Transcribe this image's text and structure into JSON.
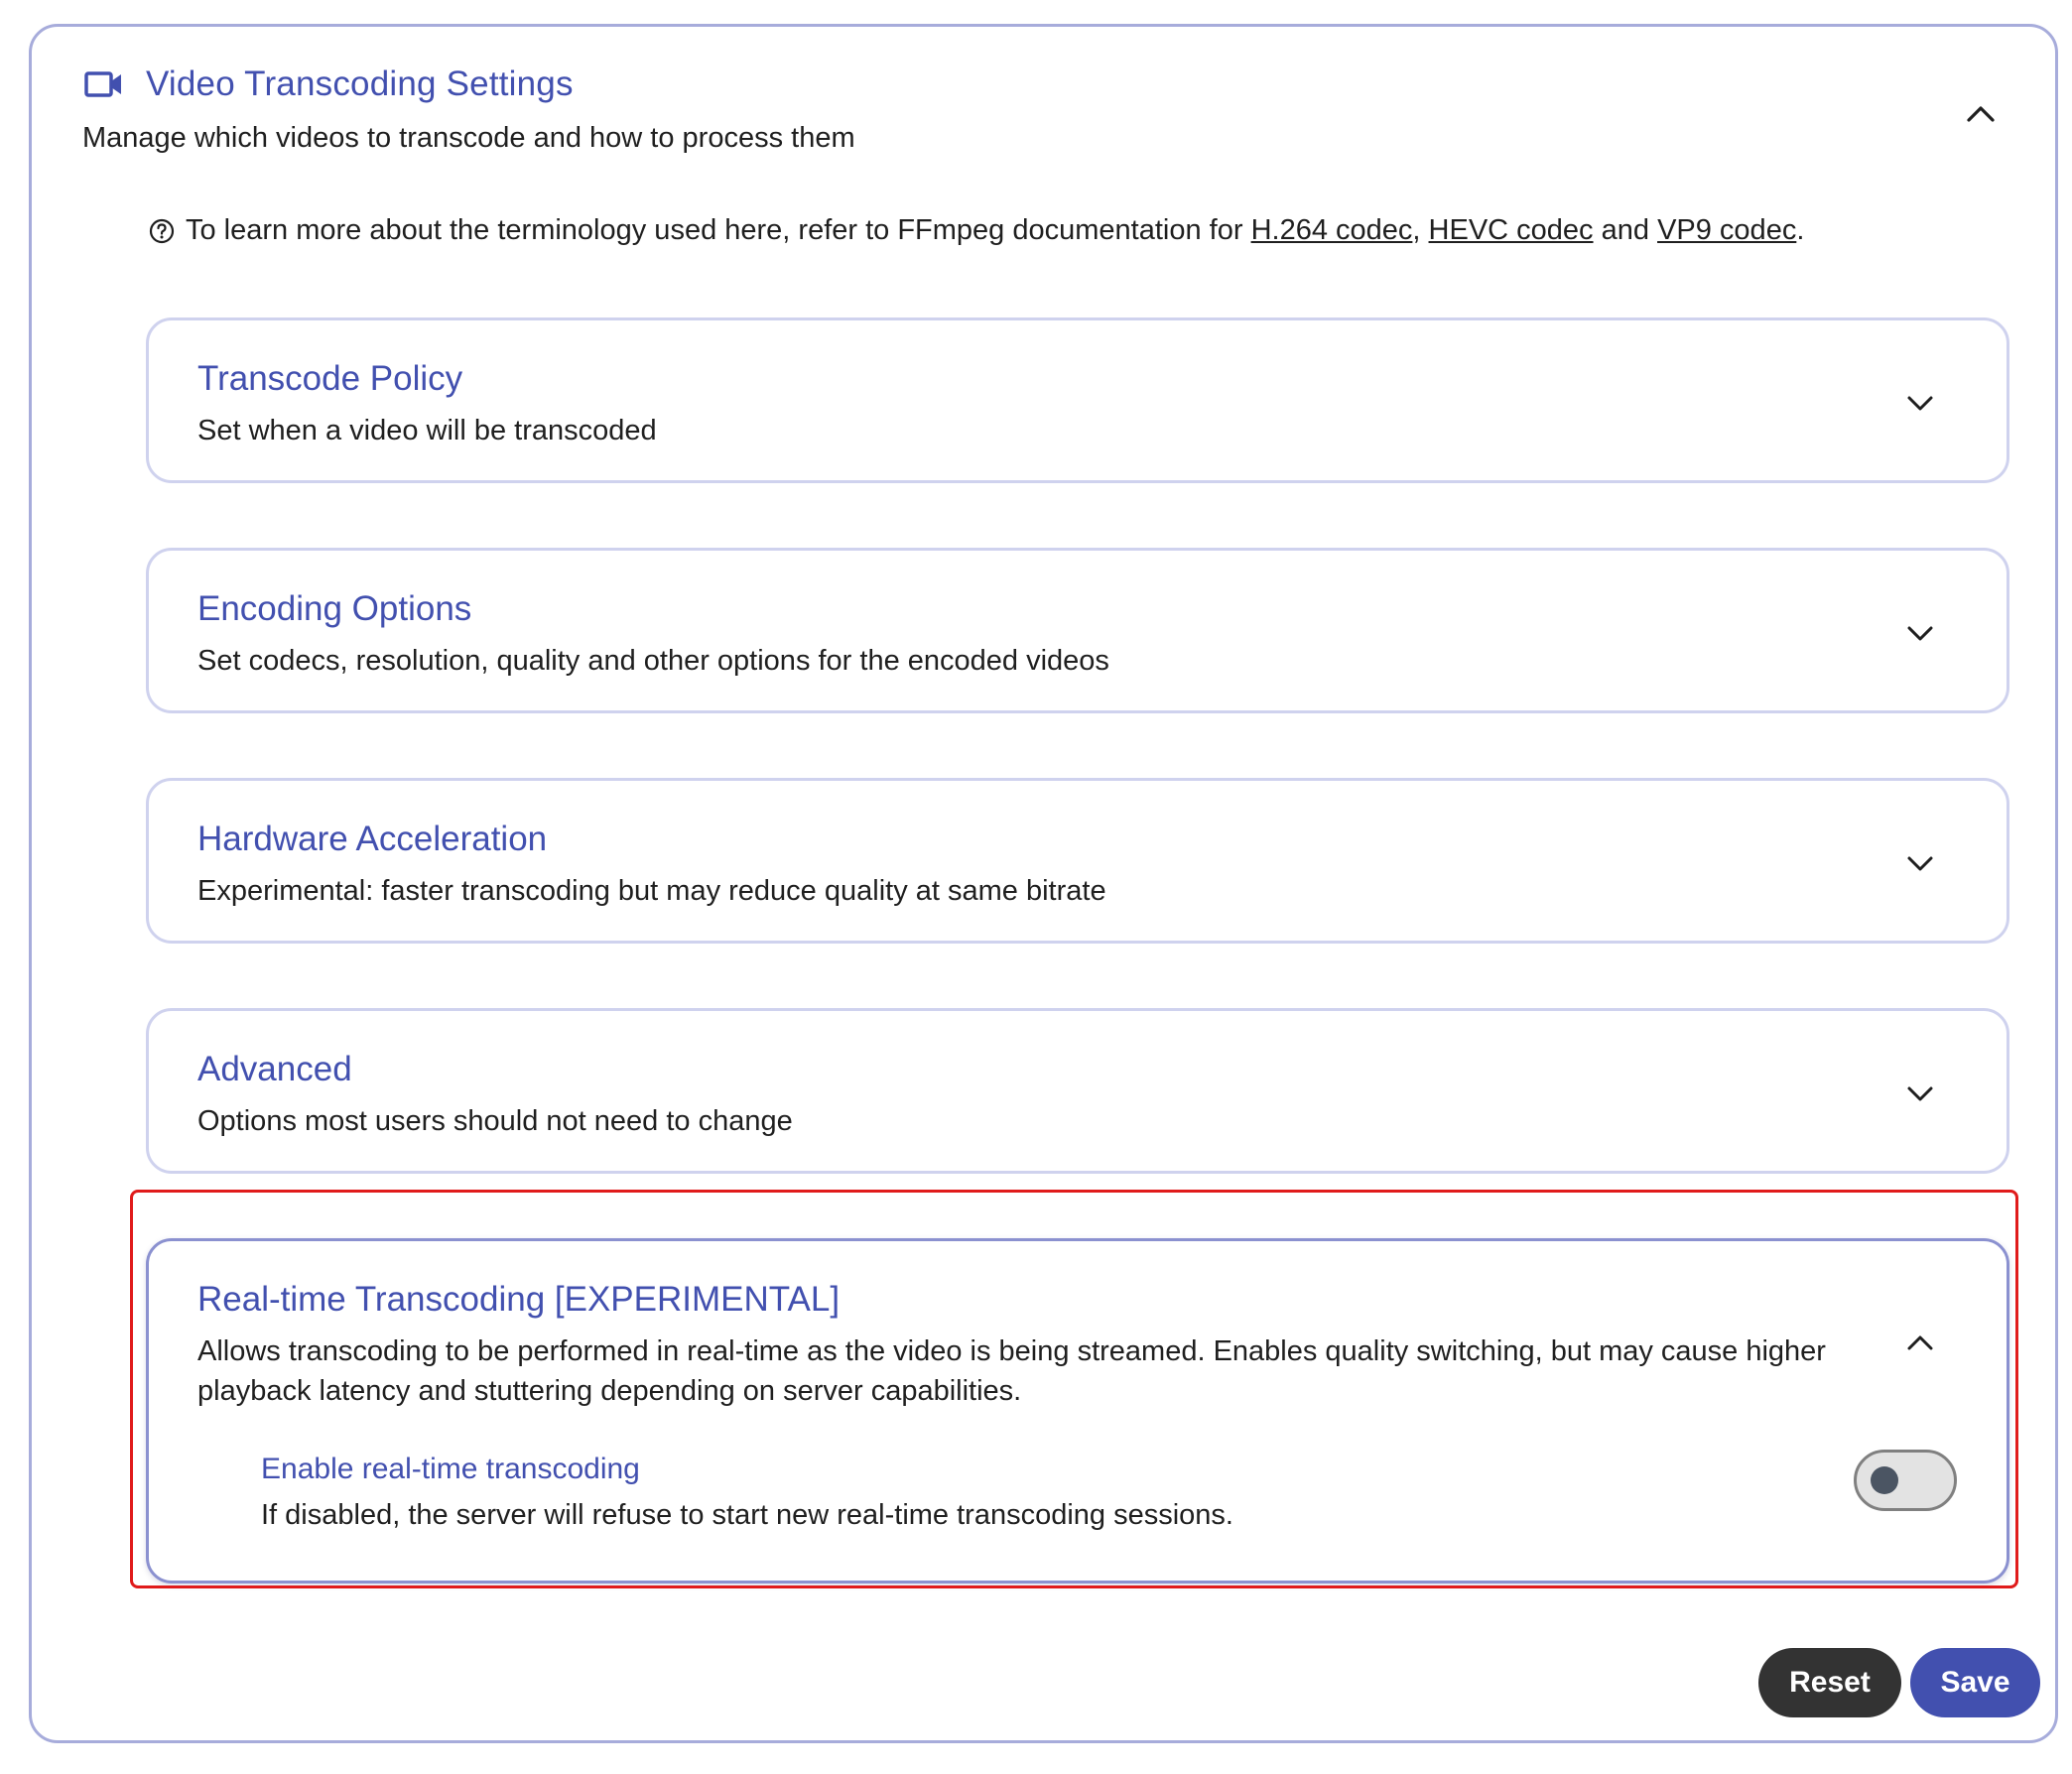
{
  "header": {
    "title": "Video Transcoding Settings",
    "subtitle": "Manage which videos to transcode and how to process them",
    "icon": "video-camera-icon",
    "expanded": true
  },
  "info": {
    "prefix": "To learn more about the terminology used here, refer to FFmpeg documentation for",
    "link1": "H.264 codec",
    "sep1": ",",
    "link2": "HEVC codec",
    "and": "and",
    "link3": "VP9 codec",
    "end": "."
  },
  "sections": [
    {
      "title": "Transcode Policy",
      "description": "Set when a video will be transcoded",
      "expanded": false
    },
    {
      "title": "Encoding Options",
      "description": "Set codecs, resolution, quality and other options for the encoded videos",
      "expanded": false
    },
    {
      "title": "Hardware Acceleration",
      "description": "Experimental: faster transcoding but may reduce quality at same bitrate",
      "expanded": false
    },
    {
      "title": "Advanced",
      "description": "Options most users should not need to change",
      "expanded": false
    },
    {
      "title": "Real-time Transcoding [EXPERIMENTAL]",
      "description": "Allows transcoding to be performed in real-time as the video is being streamed. Enables quality switching, but may cause higher playback latency and stuttering depending on server capabilities.",
      "expanded": true,
      "setting": {
        "title": "Enable real-time transcoding",
        "description": "If disabled, the server will refuse to start new real-time transcoding sessions.",
        "enabled": false
      }
    }
  ],
  "buttons": {
    "reset": "Reset",
    "save": "Save"
  },
  "colors": {
    "accent": "#4250af",
    "highlight": "#e01b1b",
    "reset_bg": "#333333"
  }
}
